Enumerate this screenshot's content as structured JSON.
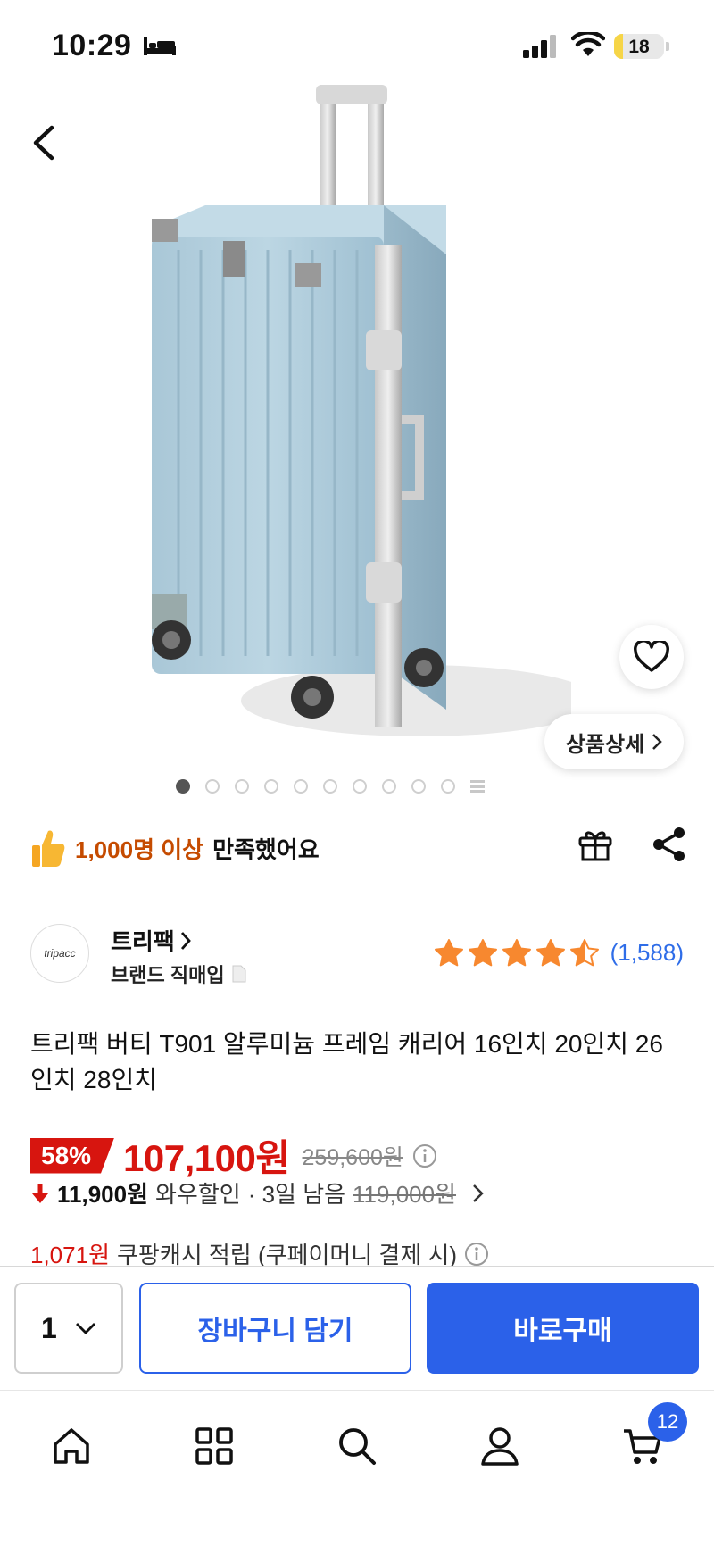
{
  "status_bar": {
    "time": "10:29",
    "battery": "18",
    "battery_level": 0.18
  },
  "gallery": {
    "detail_button_label": "상품상세",
    "image_count": 10,
    "active_index": 0
  },
  "satisfaction": {
    "count": "1,000명 이상",
    "text": "만족했어요"
  },
  "brand": {
    "logo_text": "tripacc",
    "name": "트리팩",
    "sub_label": "브랜드 직매입",
    "rating": 4.5,
    "review_count": "(1,588)"
  },
  "product": {
    "title": "트리팩 버티 T901 알루미늄 프레임 캐리어 16인치 20인치 26인치 28인치"
  },
  "price": {
    "discount": "58%",
    "sale_price": "107,100원",
    "original_price": "259,600원"
  },
  "wow": {
    "amount": "11,900원",
    "label": "와우할인",
    "days_left": "· 3일 남음",
    "original": "119,000원"
  },
  "cashback": {
    "amount": "1,071원",
    "text": "쿠팡캐시 적립 (쿠페이머니 결제 시)"
  },
  "purchase": {
    "quantity": "1",
    "cart_label": "장바구니 담기",
    "buy_label": "바로구매"
  },
  "tab_bar": {
    "cart_badge": "12",
    "accent_color": "#2b61e9"
  },
  "colors": {
    "sale_red": "#d7150f",
    "accent_blue": "#2b61e9",
    "star": "#f7882f"
  }
}
